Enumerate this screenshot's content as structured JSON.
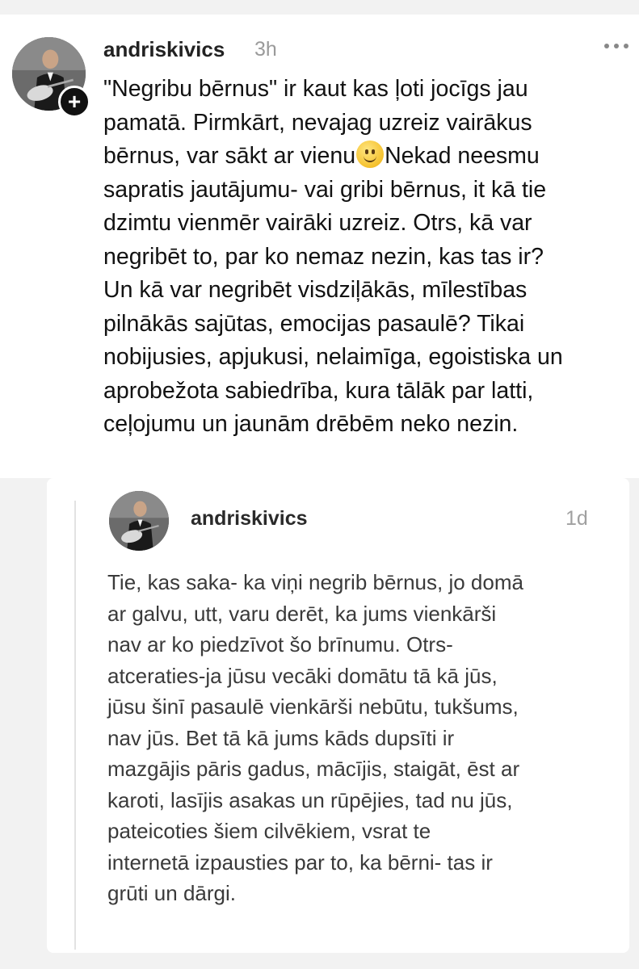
{
  "post": {
    "username": "andriskivics",
    "time": "3h",
    "text_before_emoji": "\"Negribu bērnus\" ir kaut kas ļoti jocīgs jau\npamatā. Pirmkārt, nevajag uzreiz vairākus\nbērnus, var sākt ar vienu",
    "emoji": "slightly-smiling-face-icon",
    "text_after_emoji": "Nekad neesmu\nsapratis jautājumu- vai gribi bērnus, it kā tie\ndzimtu vienmēr vairāki uzreiz. Otrs, kā var\nnegribēt to, par ko nemaz nezin, kas tas ir?\nUn kā var negribēt visdziļākās, mīlestības\npilnākās sajūtas, emocijas pasaulē? Tikai\nnobijusies, apjukusi, nelaimīga, egoistiska un\naprobežota sabiedrība, kura tālāk par latti,\nceļojumu un jaunām drēbēm neko nezin."
  },
  "reply": {
    "username": "andriskivics",
    "time": "1d",
    "text": "Tie, kas saka- ka viņi negrib bērnus, jo domā\nar galvu, utt, varu derēt, ka jums vienkārši\nnav ar ko piedzīvot šo brīnumu. Otrs-\natceraties-ja jūsu vecāki domātu tā kā jūs,\njūsu šinī pasaulē vienkārši nebūtu, tukšums,\nnav jūs. Bet tā kā jums kāds dupsīti ir\nmazgājis pāris gadus, mācījis, staigāt, ēst ar\nkaroti, lasījis asakas un rūpējies, tad nu jūs,\npateicoties šiem cilvēkiem, vsrat te\ninternetā izpausties par to, ka bērni- tas ir\ngrūti un dārgi."
  },
  "icons": {
    "more": "more-horizontal-icon",
    "follow": "plus-icon",
    "follow_symbol": "+"
  },
  "colors": {
    "page_background": "#f2f2f2",
    "card_background": "#ffffff",
    "timestamp": "#9a9a9a",
    "thread_line": "#e2e2e2"
  }
}
